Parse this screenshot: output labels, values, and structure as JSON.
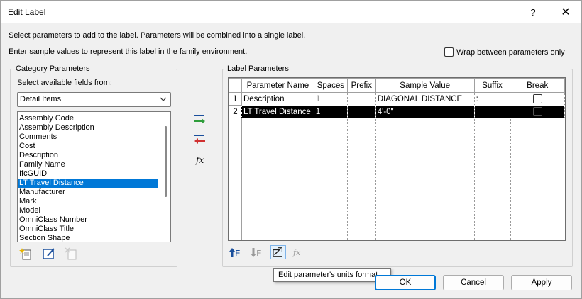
{
  "window": {
    "title": "Edit Label",
    "help_label": "?",
    "close_label": "✕"
  },
  "instructions": {
    "line1": "Select parameters to add to the label.  Parameters will be combined into a single label.",
    "line2": "Enter sample values to represent this label in the family environment."
  },
  "wrap_option": {
    "label": "Wrap between parameters only",
    "checked": false
  },
  "category": {
    "group_title": "Category Parameters",
    "fields_label": "Select available fields from:",
    "selected_category": "Detail Items",
    "fields": [
      "Assembly Code",
      "Assembly Description",
      "Comments",
      "Cost",
      "Description",
      "Family Name",
      "IfcGUID",
      "LT Travel Distance",
      "Manufacturer",
      "Mark",
      "Model",
      "OmniClass Number",
      "OmniClass Title",
      "Section Shape"
    ],
    "selected_field_index": 7,
    "bottom_icons": [
      "new-parameter-icon",
      "edit-parameter-icon",
      "delete-parameter-icon"
    ]
  },
  "middle_icons": {
    "add": "add-to-label-icon",
    "remove": "remove-from-label-icon",
    "fx": "f𝑥"
  },
  "label_params": {
    "group_title": "Label Parameters",
    "columns": [
      "Parameter Name",
      "Spaces",
      "Prefix",
      "Sample Value",
      "Suffix",
      "Break"
    ],
    "rows": [
      {
        "num": "1",
        "name": "Description",
        "spaces": "1",
        "prefix": "",
        "sample": "DIAGONAL DISTANCE",
        "suffix": ":",
        "break": false
      },
      {
        "num": "2",
        "name": "LT Travel Distance",
        "spaces": "1",
        "prefix": "",
        "sample": "4'-0\"",
        "suffix": "",
        "break": false
      }
    ],
    "selected_row_index": 1,
    "toolbar_icons": [
      "move-up-icon",
      "move-down-icon",
      "edit-units-format-icon",
      "calculated-value-icon"
    ]
  },
  "tooltip": "Edit parameter's units format",
  "buttons": {
    "ok": "OK",
    "cancel": "Cancel",
    "apply": "Apply"
  }
}
